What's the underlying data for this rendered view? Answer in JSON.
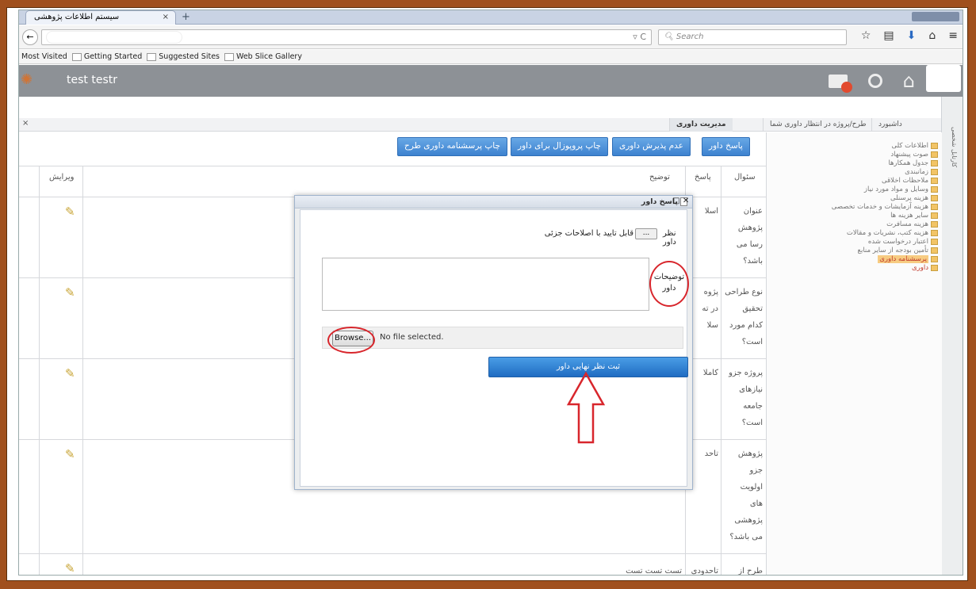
{
  "browser": {
    "tab_title": "سیستم اطلاعات پژوهشی",
    "tab_close": "×",
    "new_tab": "+",
    "search_placeholder": "Search",
    "bookmarks": [
      "Most Visited",
      "Getting Started",
      "Suggested Sites",
      "Web Slice Gallery"
    ]
  },
  "app": {
    "user_name": "test testr"
  },
  "tabs": {
    "close": "×",
    "items": [
      "داشبورد",
      "طرح/پروژه در انتظار داوری شما",
      "مدیریت داوری"
    ]
  },
  "right_panel_label": "کارتابل شخصی",
  "sidebar": {
    "items": [
      "اطلاعات کلی",
      "صوت پیشنهاد",
      "جدول همکارها",
      "زمانبندی",
      "ملاحظات اخلاقی",
      "وسایل و مواد مورد نیاز",
      "هزینه پرسنلی",
      "هزینه آزمایشات و خدمات تخصصی",
      "سایر هزینه ها",
      "هزینه مسافرت",
      "هزینه کتب، نشریات و مقالات",
      "اعتبار درخواست شده",
      "تأمین بودجه از سایر منابع",
      "پرسشنامه داوری",
      "داوری"
    ]
  },
  "toolbar": {
    "respond": "پاسخ داور",
    "reject": "عدم پذیرش داوری",
    "print_proposal": "چاپ پروپوزال برای داور",
    "print_form": "چاپ پرسشنامه داوری طرح"
  },
  "grid": {
    "headers": {
      "question": "سئوال",
      "answer": "پاسخ",
      "description": "توضیح",
      "edit": "ویرایش"
    },
    "rows": [
      {
        "question": [
          "عنوان",
          "پژوهش",
          "رسا می",
          "باشد؟"
        ],
        "answer": [
          "اسلا"
        ],
        "description": ""
      },
      {
        "question": [
          "نوع طراحی",
          "تحقیق",
          "کدام مورد",
          "است؟"
        ],
        "answer": [
          "پژوه",
          "در ته",
          "سلا"
        ],
        "description": ""
      },
      {
        "question": [
          "پروژه جزو",
          "نیازهای",
          "جامعه",
          "است؟"
        ],
        "answer": [
          "کاملا"
        ],
        "description": ""
      },
      {
        "question": [
          "پژوهش",
          "جزو",
          "اولویت",
          "های",
          "پژوهشی",
          "می باشد؟"
        ],
        "answer": [
          "تاحد"
        ],
        "description": ""
      },
      {
        "question": [
          "طرح از"
        ],
        "answer": [
          "تاحدودی"
        ],
        "description": "تست تست تست"
      }
    ]
  },
  "modal": {
    "title": "پاسخ داور",
    "controls": "□ ✕",
    "opinion_label": "نظر داور",
    "select_button": "...",
    "selected_value": "قابل تایید با اصلاحات جزئی",
    "desc_label_1": "توضیحات",
    "desc_label_2": "داور",
    "browse": "Browse...",
    "no_file": "No file selected.",
    "submit": "ثبت نظر نهایی داور"
  },
  "colors": {
    "frame": "#a0501e",
    "header": "#8d9196",
    "button": "#3d82cf",
    "annotation": "#d8262c"
  }
}
